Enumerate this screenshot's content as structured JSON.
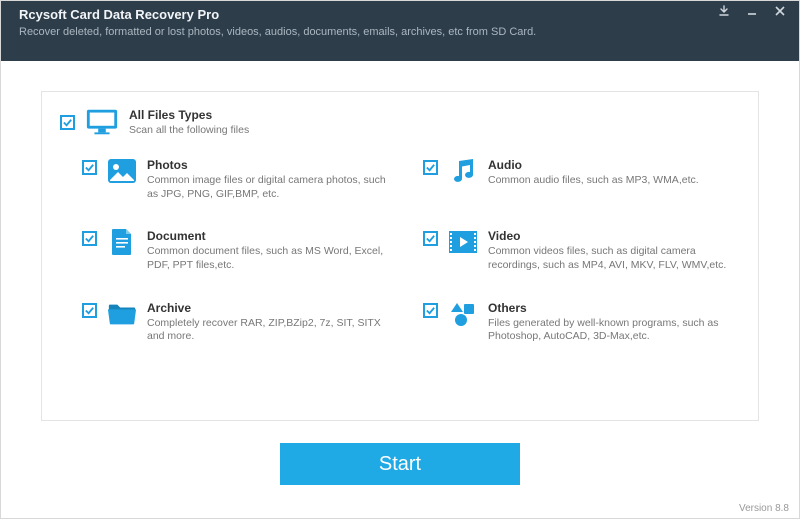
{
  "header": {
    "title": "Rcysoft Card Data Recovery Pro",
    "subtitle": "Recover deleted, formatted or lost photos, videos, audios, documents, emails, archives, etc from SD Card."
  },
  "allFiles": {
    "label": "All Files Types",
    "desc": "Scan all the following files"
  },
  "categories": {
    "photos": {
      "label": "Photos",
      "desc": "Common image files or digital camera photos, such as JPG, PNG, GIF,BMP, etc."
    },
    "audio": {
      "label": "Audio",
      "desc": "Common audio files, such as MP3, WMA,etc."
    },
    "document": {
      "label": "Document",
      "desc": "Common document files, such as MS Word, Excel, PDF, PPT files,etc."
    },
    "video": {
      "label": "Video",
      "desc": "Common videos files, such as digital camera recordings, such as MP4, AVI, MKV, FLV, WMV,etc."
    },
    "archive": {
      "label": "Archive",
      "desc": "Completely recover RAR, ZIP,BZip2, 7z, SIT, SITX and more."
    },
    "others": {
      "label": "Others",
      "desc": "Files generated by well-known programs, such as Photoshop, AutoCAD, 3D-Max,etc."
    }
  },
  "startButton": "Start",
  "version": "Version 8.8",
  "colors": {
    "accent": "#20aae5",
    "header": "#2e3d4a"
  }
}
